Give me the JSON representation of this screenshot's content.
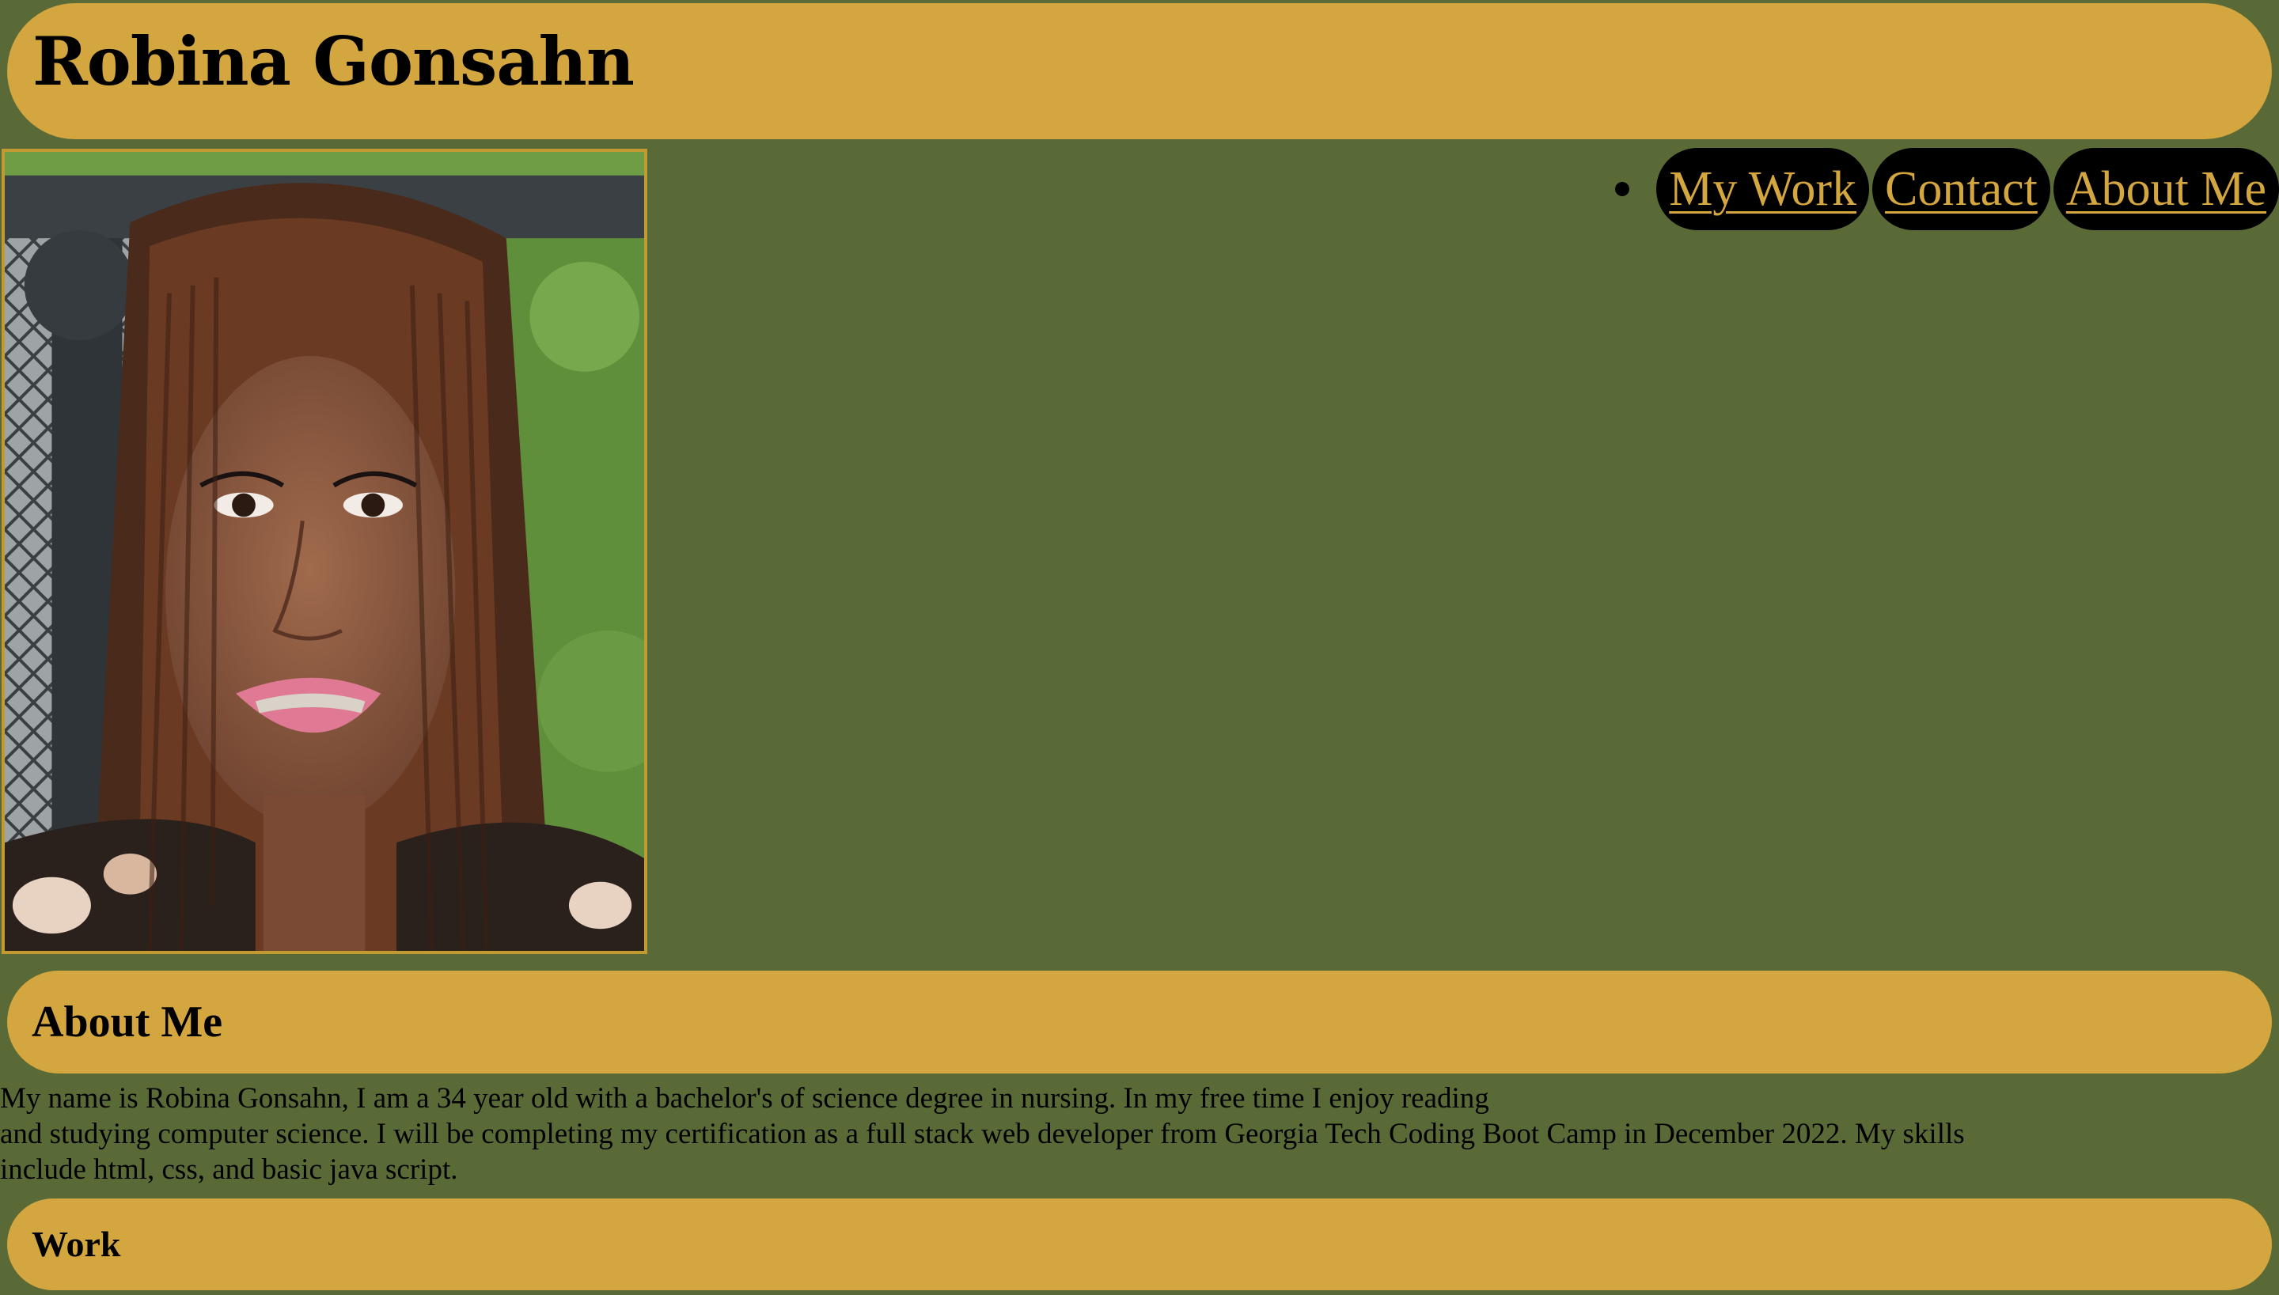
{
  "header": {
    "title": "Robina Gonsahn"
  },
  "nav": {
    "links": [
      "My Work",
      "Contact",
      "About Me"
    ]
  },
  "about": {
    "heading": "About Me",
    "lines": [
      "My name is Robina Gonsahn, I am a 34 year old with a bachelor's of science degree in nursing. In my free time I enjoy reading",
      "and studying computer science. I will be completing my certification as a full stack web developer from Georgia Tech Coding Boot Camp in December 2022. My skills",
      "include html, css, and basic java script."
    ]
  },
  "work": {
    "heading": "Work"
  },
  "colors": {
    "background": "#596a37",
    "accent": "#d4a640",
    "nav_pill": "#000000"
  }
}
